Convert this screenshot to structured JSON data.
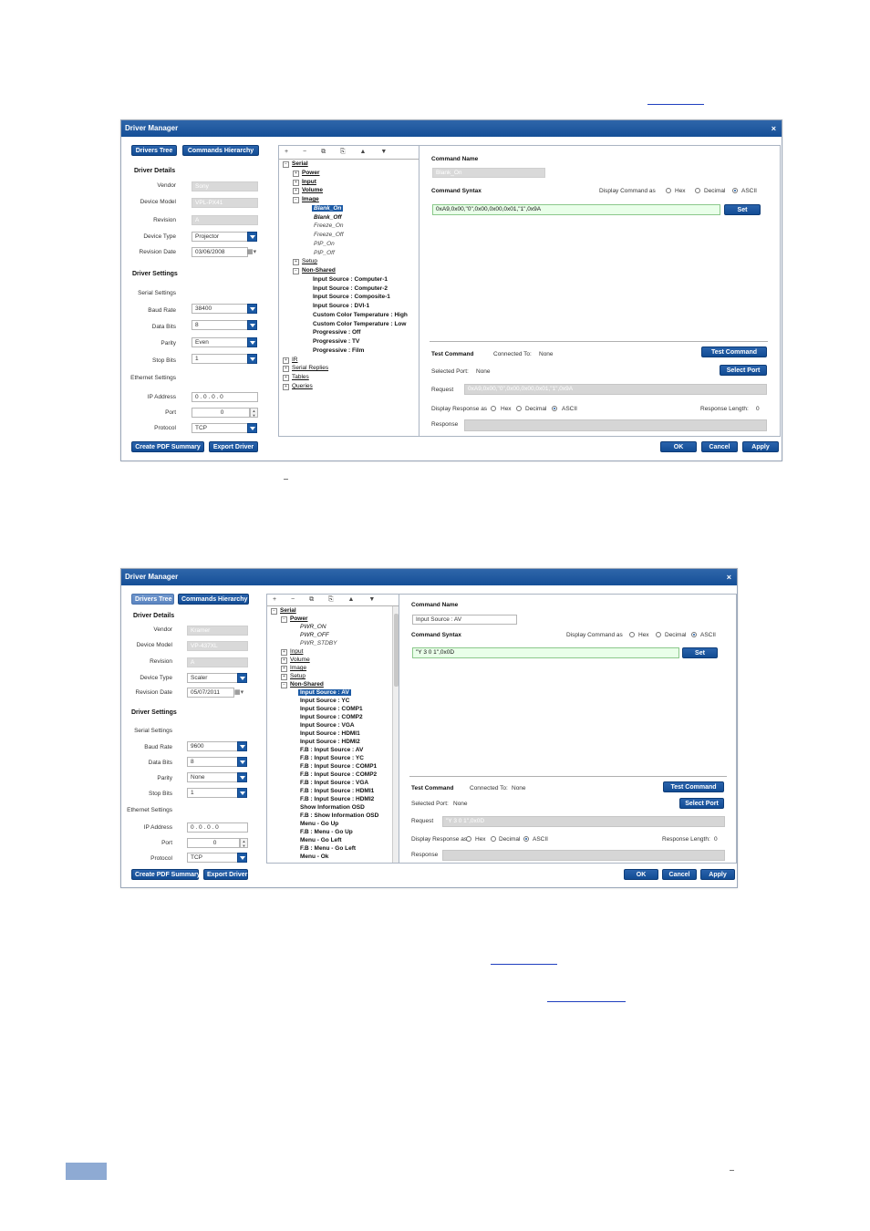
{
  "window1": {
    "title": "Driver Manager",
    "close": "×",
    "tabs": {
      "drivers_tree": "Drivers Tree",
      "commands_hierarchy": "Commands Hierarchy"
    },
    "driver_details": {
      "heading": "Driver Details",
      "vendor_label": "Vendor",
      "vendor": "Sony",
      "model_label": "Device Model",
      "model": "VPL-PX41",
      "revision_label": "Revision",
      "revision": "A",
      "type_label": "Device Type",
      "type": "Projector",
      "date_label": "Revision Date",
      "date": "03/06/2008"
    },
    "driver_settings": {
      "heading": "Driver Settings",
      "serial_label": "Serial Settings",
      "baud_label": "Baud Rate",
      "baud": "38400",
      "databits_label": "Data Bits",
      "databits": "8",
      "parity_label": "Parity",
      "parity": "Even",
      "stopbits_label": "Stop Bits",
      "stopbits": "1",
      "ethernet_label": "Ethernet Settings",
      "ip_label": "IP Address",
      "ip": "0 . 0 . 0 . 0",
      "port_label": "Port",
      "port": "0",
      "protocol_label": "Protocol",
      "protocol": "TCP"
    },
    "toolbar": "+ − ⧉ ⎘ ▲ ▼",
    "tree": {
      "serial": "Serial",
      "power": "Power",
      "input": "Input",
      "volume": "Volume",
      "image": "Image",
      "image_children": [
        "Blank_On",
        "Blank_Off",
        "Freeze_On",
        "Freeze_Off",
        "PIP_On",
        "PIP_Off"
      ],
      "setup": "Setup",
      "non_shared": "Non-Shared",
      "non_shared_children": [
        "Input Source : Computer-1",
        "Input Source : Computer-2",
        "Input Source : Composite-1",
        "Input Source : DVI-1",
        "Custom Color Temperature : High",
        "Custom Color Temperature : Low",
        "Progressive : Off",
        "Progressive : TV",
        "Progressive : Film"
      ],
      "ir": "IR",
      "serial_replies": "Serial Replies",
      "tables": "Tables",
      "queries": "Queries"
    },
    "command": {
      "name_label": "Command Name",
      "name": "Blank_On",
      "syntax_label": "Command Syntax",
      "display_as": "Display Command as",
      "hex": "Hex",
      "decimal": "Decimal",
      "ascii": "ASCII",
      "syntax": "0xA9,0x00,\"0\",0x00,0x00,0x01,\"1\",0x9A",
      "set": "Set"
    },
    "test": {
      "label": "Test Command",
      "connected": "Connected To:",
      "connected_val": "None",
      "test_btn": "Test Command",
      "selected_port": "Selected Port:",
      "selected_val": "None",
      "select_btn": "Select Port",
      "request_label": "Request",
      "request": "0xA9,0x00,\"0\",0x00,0x00,0x01,\"1\",0x9A",
      "display_response": "Display Response as",
      "hex": "Hex",
      "decimal": "Decimal",
      "ascii": "ASCII",
      "resp_len_label": "Response Length:",
      "resp_len": "0",
      "response_label": "Response"
    },
    "footer": {
      "pdf": "Create PDF Summary",
      "export": "Export Driver",
      "ok": "OK",
      "cancel": "Cancel",
      "apply": "Apply"
    }
  },
  "window2": {
    "title": "Driver Manager",
    "close": "×",
    "tabs": {
      "drivers_tree": "Drivers Tree",
      "commands_hierarchy": "Commands Hierarchy"
    },
    "driver_details": {
      "heading": "Driver Details",
      "vendor_label": "Vendor",
      "vendor": "Kramer",
      "model_label": "Device Model",
      "model": "VP-437XL",
      "revision_label": "Revision",
      "revision": "A",
      "type_label": "Device Type",
      "type": "Scaler",
      "date_label": "Revision Date",
      "date": "05/07/2011"
    },
    "driver_settings": {
      "heading": "Driver Settings",
      "serial_label": "Serial Settings",
      "baud_label": "Baud Rate",
      "baud": "9600",
      "databits_label": "Data Bits",
      "databits": "8",
      "parity_label": "Parity",
      "parity": "None",
      "stopbits_label": "Stop Bits",
      "stopbits": "1",
      "ethernet_label": "Ethernet Settings",
      "ip_label": "IP Address",
      "ip": "0 . 0 . 0 . 0",
      "port_label": "Port",
      "port": "0",
      "protocol_label": "Protocol",
      "protocol": "TCP"
    },
    "toolbar": "+ − ⧉ ⎘ ▲ ▼",
    "tree": {
      "serial": "Serial",
      "power": "Power",
      "power_children": [
        "PWR_ON",
        "PWR_OFF",
        "PWR_STDBY"
      ],
      "input": "Input",
      "volume": "Volume",
      "image": "Image",
      "setup": "Setup",
      "non_shared": "Non-Shared",
      "non_shared_children": [
        "Input Source : AV",
        "Input Source : YC",
        "Input Source : COMP1",
        "Input Source : COMP2",
        "Input Source : VGA",
        "Input Source : HDMI1",
        "Input Source : HDMI2",
        "F.B : Input Source : AV",
        "F.B : Input Source : YC",
        "F.B : Input Source : COMP1",
        "F.B : Input Source : COMP2",
        "F.B : Input Source : VGA",
        "F.B : Input Source : HDMI1",
        "F.B : Input Source : HDMI2",
        "Show Information OSD",
        "F.B : Show Information OSD",
        "Menu - Go Up",
        "F.B : Menu - Go Up",
        "Menu - Go Left",
        "F.B : Menu - Go Left",
        "Menu - Ok"
      ]
    },
    "command": {
      "name_label": "Command Name",
      "name": "Input Source : AV",
      "syntax_label": "Command Syntax",
      "display_as": "Display Command as",
      "hex": "Hex",
      "decimal": "Decimal",
      "ascii": "ASCII",
      "syntax": "\"Y 3 0 1\",0x0D",
      "set": "Set"
    },
    "test": {
      "label": "Test Command",
      "connected": "Connected To:",
      "connected_val": "None",
      "test_btn": "Test Command",
      "selected_port": "Selected Port:",
      "selected_val": "None",
      "select_btn": "Select Port",
      "request_label": "Request",
      "request": "\"Y 3 0 1\",0x0D",
      "display_response": "Display Response as",
      "hex": "Hex",
      "decimal": "Decimal",
      "ascii": "ASCII",
      "resp_len_label": "Response Length:",
      "resp_len": "0",
      "response_label": "Response"
    },
    "footer": {
      "pdf": "Create PDF Summary",
      "export": "Export Driver",
      "ok": "OK",
      "cancel": "Cancel",
      "apply": "Apply"
    }
  }
}
